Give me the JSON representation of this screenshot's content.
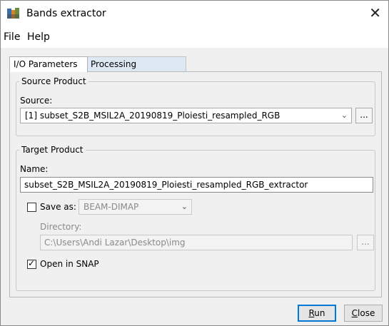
{
  "window": {
    "title": "Bands extractor",
    "close_symbol": "✕"
  },
  "menu": {
    "file": "File",
    "help": "Help"
  },
  "tabs": {
    "io": "I/O Parameters",
    "processing": "Processing Parameters"
  },
  "source": {
    "group_title": "Source Product",
    "label": "Source:",
    "value": "[1] subset_S2B_MSIL2A_20190819_Ploiesti_resampled_RGB",
    "browse": "..."
  },
  "target": {
    "group_title": "Target Product",
    "name_label": "Name:",
    "name_value": "subset_S2B_MSIL2A_20190819_Ploiesti_resampled_RGB_extractor",
    "save_as_label": "Save as:",
    "save_as_checked": false,
    "format": "BEAM-DIMAP",
    "directory_label": "Directory:",
    "directory_value": "C:\\Users\\Andi Lazar\\Desktop\\img",
    "directory_browse": "...",
    "open_in_snap_label": "Open in SNAP",
    "open_in_snap_checked": true
  },
  "buttons": {
    "run_first": "R",
    "run_rest": "un",
    "close_first": "C",
    "close_rest": "lose"
  },
  "colors": {
    "accent": "#0078d7",
    "inactive_tab": "#dde8f3"
  }
}
